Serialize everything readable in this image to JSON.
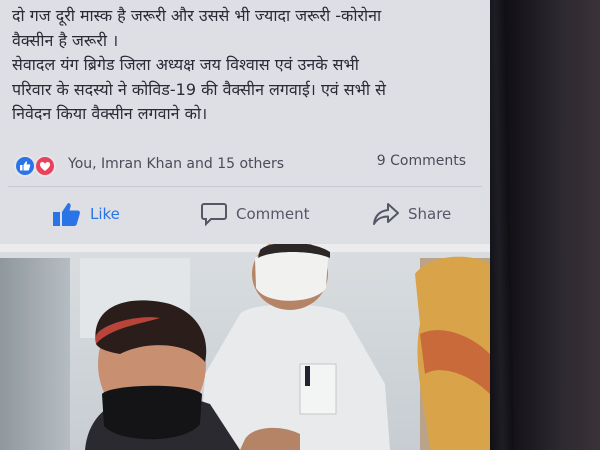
{
  "post": {
    "lines": [
      "दो गज दूरी मास्क है जरूरी और उससे भी ज्यादा जरूरी -कोरोना",
      "वैक्सीन है जरूरी ।",
      "सेवादल यंग ब्रिगेड जिला अध्यक्ष जय विश्वास एवं उनके सभी",
      "परिवार के सदस्यो ने कोविड-19 की वैक्सीन लगवाई। एवं सभी से",
      "निवेदन किया वैक्सीन लगवाने को।"
    ]
  },
  "reactions": {
    "names": "You, Imran Khan and 15 others",
    "comments": "9 Comments",
    "icons": [
      "like-icon",
      "love-icon"
    ]
  },
  "actions": {
    "like": "Like",
    "comment": "Comment",
    "share": "Share"
  },
  "colors": {
    "like_blue": "#2a74e8",
    "love_red": "#e9435b",
    "text": "#2c2a36"
  }
}
